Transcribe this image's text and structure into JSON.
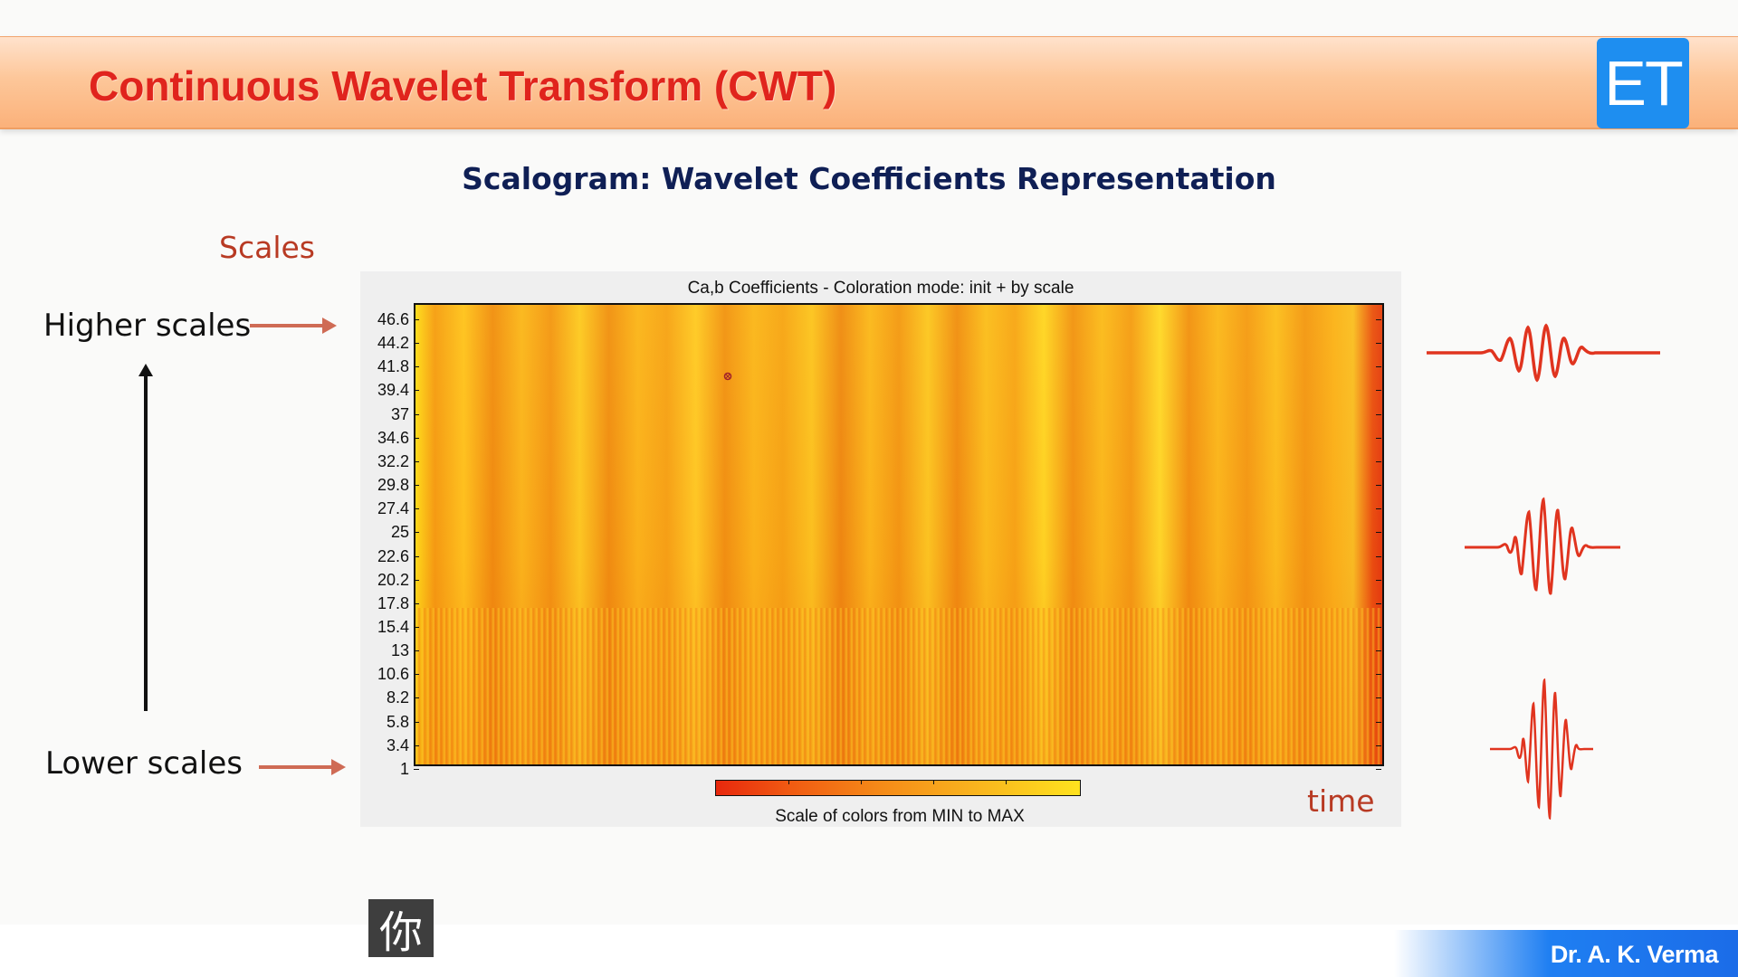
{
  "header": {
    "title": "Continuous Wavelet Transform (CWT)",
    "logo_text": "ET"
  },
  "slide": {
    "subtitle": "Scalogram: Wavelet Coefficients Representation",
    "scales_label": "Scales",
    "higher_scales_label": "Higher scales",
    "lower_scales_label": "Lower scales",
    "time_label": "time"
  },
  "plot": {
    "title": "Ca,b Coefficients - Coloration mode: init + by scale",
    "colorbar_label": "Scale of colors from MIN to MAX",
    "y_ticks": [
      "46.6",
      "44.2",
      "41.8",
      "39.4",
      "37",
      "34.6",
      "32.2",
      "29.8",
      "27.4",
      "25",
      "22.6",
      "20.2",
      "17.8",
      "15.4",
      "13",
      "10.6",
      "8.2",
      "5.8",
      "3.4",
      "1"
    ]
  },
  "colors": {
    "header_title": "#e0241d",
    "subtitle": "#0f1f55",
    "accent_label": "#b83a23",
    "logo_bg": "#1e8ef0",
    "wavelet": "#e0341f"
  },
  "footer": {
    "author": "Dr. A. K. Verma"
  },
  "caption_overlay": {
    "glyph": "你"
  }
}
